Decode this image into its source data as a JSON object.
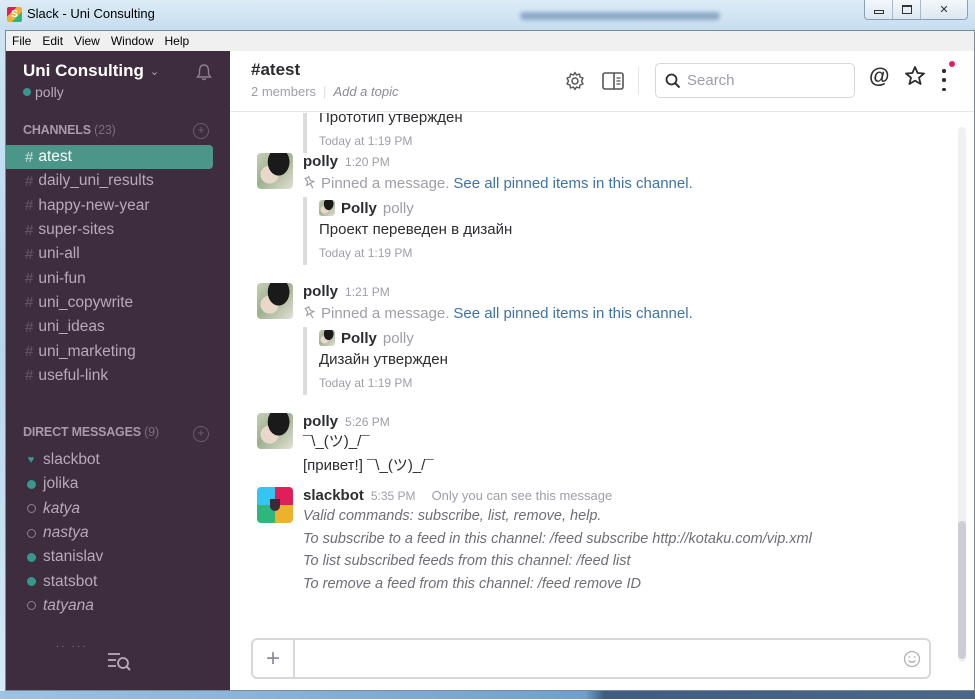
{
  "window": {
    "title": "Slack - Uni Consulting",
    "controls": {
      "minimize": "minimize",
      "maximize": "maximize",
      "close": "close"
    }
  },
  "menubar": [
    "File",
    "Edit",
    "View",
    "Window",
    "Help"
  ],
  "sidebar": {
    "team_name": "Uni Consulting",
    "user": "polly",
    "channels_header": "CHANNELS",
    "channels_count": "(23)",
    "channels": [
      {
        "name": "atest",
        "active": true
      },
      {
        "name": "daily_uni_results",
        "active": false
      },
      {
        "name": "happy-new-year",
        "active": false
      },
      {
        "name": "super-sites",
        "active": false
      },
      {
        "name": "uni-all",
        "active": false
      },
      {
        "name": "uni-fun",
        "active": false
      },
      {
        "name": "uni_copywrite",
        "active": false
      },
      {
        "name": "uni_ideas",
        "active": false
      },
      {
        "name": "uni_marketing",
        "active": false
      },
      {
        "name": "useful-link",
        "active": false
      }
    ],
    "dm_header": "DIRECT MESSAGES",
    "dm_count": "(9)",
    "direct_messages": [
      {
        "name": "slackbot",
        "presence": "bot"
      },
      {
        "name": "jolika",
        "presence": "online"
      },
      {
        "name": "katya",
        "presence": "away"
      },
      {
        "name": "nastya",
        "presence": "away"
      },
      {
        "name": "stanislav",
        "presence": "online"
      },
      {
        "name": "statsbot",
        "presence": "online"
      },
      {
        "name": "tatyana",
        "presence": "away"
      }
    ]
  },
  "header": {
    "channel": "#atest",
    "members": "2 members",
    "topic_placeholder": "Add a topic",
    "search_placeholder": "Search"
  },
  "messages": {
    "top_fragment": {
      "text": "Прототип утвержден",
      "timestamp": "Today at 1:19 PM"
    },
    "items": [
      {
        "author": "polly",
        "time": "1:20 PM",
        "pin_text": "Pinned a message.",
        "pin_link": "See all pinned items in this channel.",
        "quote": {
          "name": "Polly",
          "username": "polly",
          "text": "Проект переведен в дизайн",
          "timestamp": "Today at 1:19 PM"
        }
      },
      {
        "author": "polly",
        "time": "1:21 PM",
        "pin_text": "Pinned a message.",
        "pin_link": "See all pinned items in this channel.",
        "quote": {
          "name": "Polly",
          "username": "polly",
          "text": "Дизайн утвержден",
          "timestamp": "Today at 1:19 PM"
        }
      },
      {
        "author": "polly",
        "time": "5:26 PM",
        "lines": [
          "¯\\_(ツ)_/¯",
          "[привет!] ¯\\_(ツ)_/¯"
        ]
      },
      {
        "author": "slackbot",
        "time": "5:35 PM",
        "ephemeral": "Only you can see this message",
        "lines": [
          "Valid commands: subscribe, list, remove, help.",
          "To subscribe to a feed in this channel: /feed subscribe http://kotaku.com/vip.xml",
          "To list subscribed feeds from this channel: /feed list",
          "To remove a feed from this channel: /feed remove ID"
        ]
      }
    ]
  },
  "composer": {
    "value": "",
    "placeholder": ""
  },
  "colors": {
    "sidebar_bg": "#3e2c3f",
    "active_channel": "#4c9689",
    "presence_online": "#38978d",
    "link": "#3e73a8",
    "notification": "#e0245e"
  }
}
